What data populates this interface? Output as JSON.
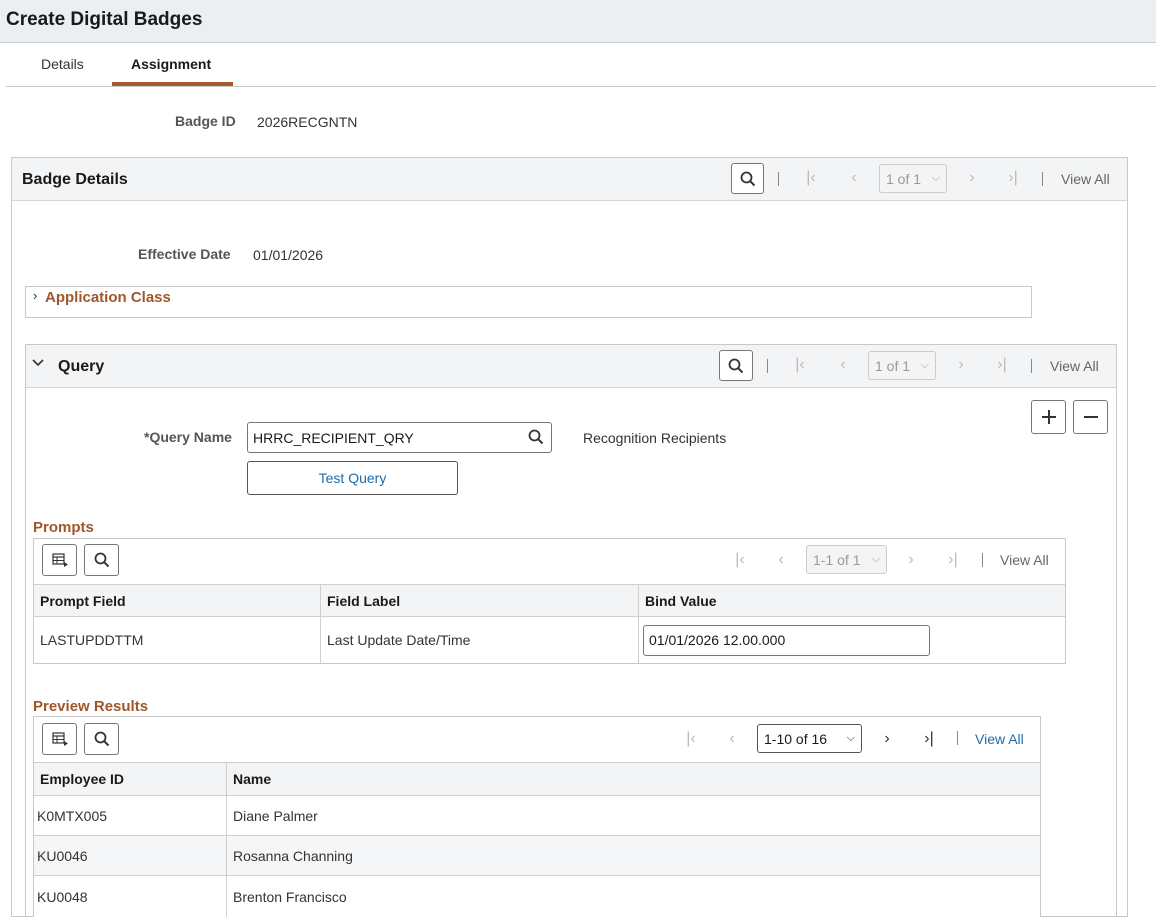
{
  "page": {
    "title": "Create Digital Badges"
  },
  "tabs": [
    {
      "label": "Details"
    },
    {
      "label": "Assignment"
    }
  ],
  "badge": {
    "id_label": "Badge ID",
    "id_value": "2026RECGNTN"
  },
  "badge_details": {
    "title": "Badge Details",
    "pager": {
      "count": "1 of 1",
      "view_all": "View All"
    },
    "effective_date_label": "Effective Date",
    "effective_date_value": "01/01/2026",
    "application_class_label": "Application Class"
  },
  "query": {
    "title": "Query",
    "pager": {
      "count": "1 of 1",
      "view_all": "View All"
    },
    "name_label": "*Query Name",
    "name_value": "HRRC_RECIPIENT_QRY",
    "description": "Recognition Recipients",
    "test_button": "Test Query"
  },
  "prompts": {
    "title": "Prompts",
    "pager": {
      "count": "1-1 of 1",
      "view_all": "View All"
    },
    "columns": [
      "Prompt Field",
      "Field Label",
      "Bind Value"
    ],
    "rows": [
      {
        "prompt_field": "LASTUPDDTTM",
        "field_label": "Last Update Date/Time",
        "bind_value": "01/01/2026 12.00.000"
      }
    ]
  },
  "preview": {
    "title": "Preview Results",
    "pager": {
      "count": "1-10 of 16",
      "view_all": "View All"
    },
    "columns": [
      "Employee ID",
      "Name"
    ],
    "rows": [
      {
        "employee_id": "K0MTX005",
        "name": "Diane Palmer"
      },
      {
        "employee_id": "KU0046",
        "name": "Rosanna Channing"
      },
      {
        "employee_id": "KU0048",
        "name": "Brenton Francisco"
      }
    ]
  }
}
